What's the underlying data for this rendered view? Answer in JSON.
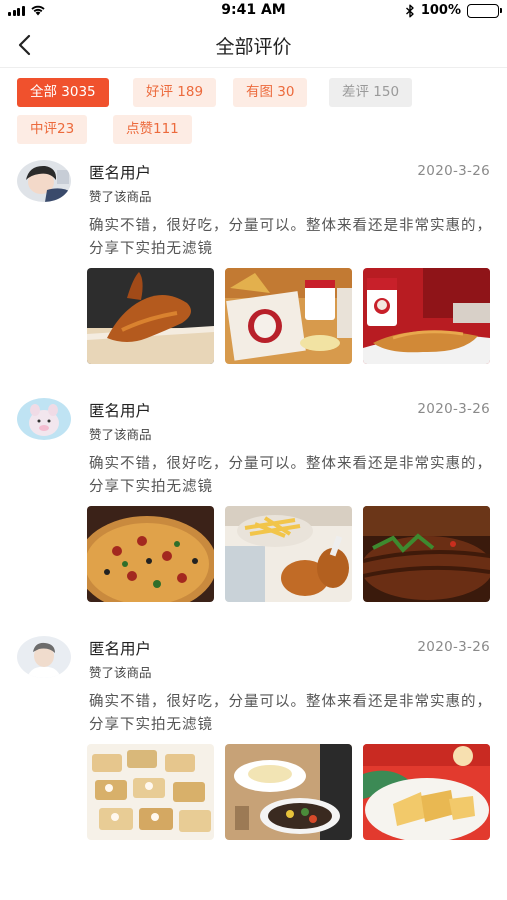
{
  "status_bar": {
    "time": "9:41 AM",
    "battery": "100%"
  },
  "nav": {
    "title": "全部评价"
  },
  "filters": [
    {
      "label": "全部 3035",
      "state": "active"
    },
    {
      "label": "好评 189",
      "state": "soft"
    },
    {
      "label": "有图 30",
      "state": "soft"
    },
    {
      "label": "差评 150",
      "state": "gray"
    },
    {
      "label": "中评23",
      "state": "soft"
    },
    {
      "label": "点赞111",
      "state": "soft"
    }
  ],
  "reviews": [
    {
      "username": "匿名用户",
      "date": "2020-3-26",
      "liked_text": "赞了该商品",
      "text": "确实不错，很好吃，分量可以。整体来看还是非常实惠的，分享下实拍无滤镜",
      "photos": [
        "fried-chicken-wing-photo",
        "kfc-bucket-meal-photo",
        "kfc-restaurant-tenders-photo"
      ]
    },
    {
      "username": "匿名用户",
      "date": "2020-3-26",
      "liked_text": "赞了该商品",
      "text": "确实不错，很好吃，分量可以。整体来看还是非常实惠的，分享下实拍无滤镜",
      "photos": [
        "pizza-photo",
        "fries-drumsticks-photo",
        "grilled-steak-photo"
      ]
    },
    {
      "username": "匿名用户",
      "date": "2020-3-26",
      "liked_text": "赞了该商品",
      "text": "确实不错，很好吃，分量可以。整体来看还是非常实惠的，分享下实拍无滤镜",
      "photos": [
        "canapes-photo",
        "pasta-dishes-photo",
        "french-toast-photo"
      ]
    }
  ],
  "colors": {
    "accent": "#f0512d",
    "soft_bg": "#fdece4",
    "soft_text": "#ec6a3c"
  }
}
